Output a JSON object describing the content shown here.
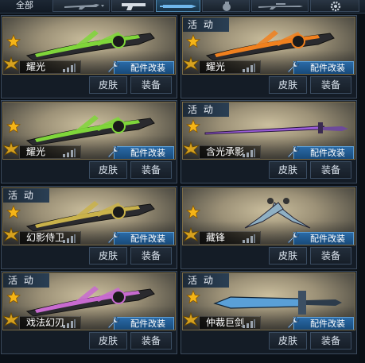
{
  "top_tabs": {
    "all_label": "全部",
    "tabs": [
      {
        "icon": "rifle-icon"
      },
      {
        "icon": "pistol-icon"
      },
      {
        "icon": "knife-icon",
        "active": true
      },
      {
        "icon": "grenade-icon"
      },
      {
        "icon": "sniper-icon"
      },
      {
        "icon": "gear-icon"
      }
    ]
  },
  "labels": {
    "skin": "皮肤",
    "equip": "装备",
    "mod": "配件改装"
  },
  "cards": [
    {
      "name": "耀光",
      "badge": "",
      "weapon_color": "#7fd63a"
    },
    {
      "name": "耀光",
      "badge": "活 动",
      "weapon_color": "#f0801e"
    },
    {
      "name": "耀光",
      "badge": "",
      "weapon_color": "#7fd63a"
    },
    {
      "name": "含光承影",
      "badge": "活 动",
      "weapon_color": "#9a5cd8"
    },
    {
      "name": "幻影侍卫",
      "badge": "活 动",
      "weapon_color": "#c9b24a"
    },
    {
      "name": "藏锋",
      "badge": "",
      "weapon_color": "#8fb0c4"
    },
    {
      "name": "戏法幻刃",
      "badge": "活 动",
      "weapon_color": "#c86ad0"
    },
    {
      "name": "仲裁巨剑",
      "badge": "活 动",
      "weapon_color": "#5aa0d8"
    }
  ],
  "colors": {
    "accent": "#2a6aa6",
    "badge_text": "#e9eef5"
  }
}
